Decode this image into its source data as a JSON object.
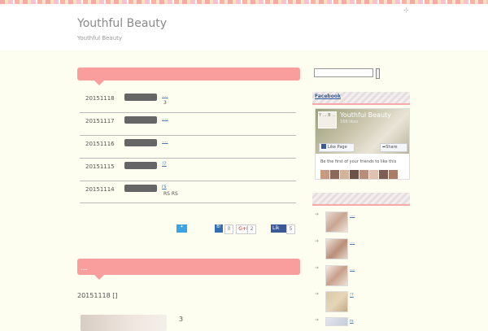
{
  "header": {
    "site_title": "Youthful Beauty",
    "site_description": "Youthful Beauty",
    "icon": "expand-icon"
  },
  "main": {
    "news_rows": [
      {
        "date": "20151118",
        "link": "....",
        "sub": "3"
      },
      {
        "date": "20151117",
        "link": "....",
        "sub": ""
      },
      {
        "date": "20151116",
        "link": "....",
        "sub": ""
      },
      {
        "date": "20151115",
        "link": "!?",
        "sub": ""
      },
      {
        "date": "20151114",
        "link": "rs",
        "sub": "RS RS"
      }
    ],
    "share": {
      "hatena_count": "0",
      "gplus_label": "G+I",
      "gplus_count": "2",
      "fb_label": "Lik",
      "fb_count": "5"
    },
    "second_bar_text": "....",
    "post_title": "20151118 []",
    "post_number": "3"
  },
  "sidebar": {
    "facebook_heading": "Facebook",
    "fb": {
      "page_name": "Youthful Beauty",
      "likes": "168 likes",
      "logo_text": "Y ... B ...",
      "like_button": "Like Page",
      "share_button": "Share",
      "friends_text": "Be the first of your friends to like this"
    },
    "items": [
      {
        "link": "...."
      },
      {
        "link": "...."
      },
      {
        "link": "...."
      },
      {
        "link": "!?"
      },
      {
        "link": "rs"
      }
    ]
  },
  "colors": {
    "accent_pink": "#f99d9d",
    "background": "#fdfdf0",
    "facebook_blue": "#3b5998",
    "twitter_blue": "#3aa3e0"
  }
}
